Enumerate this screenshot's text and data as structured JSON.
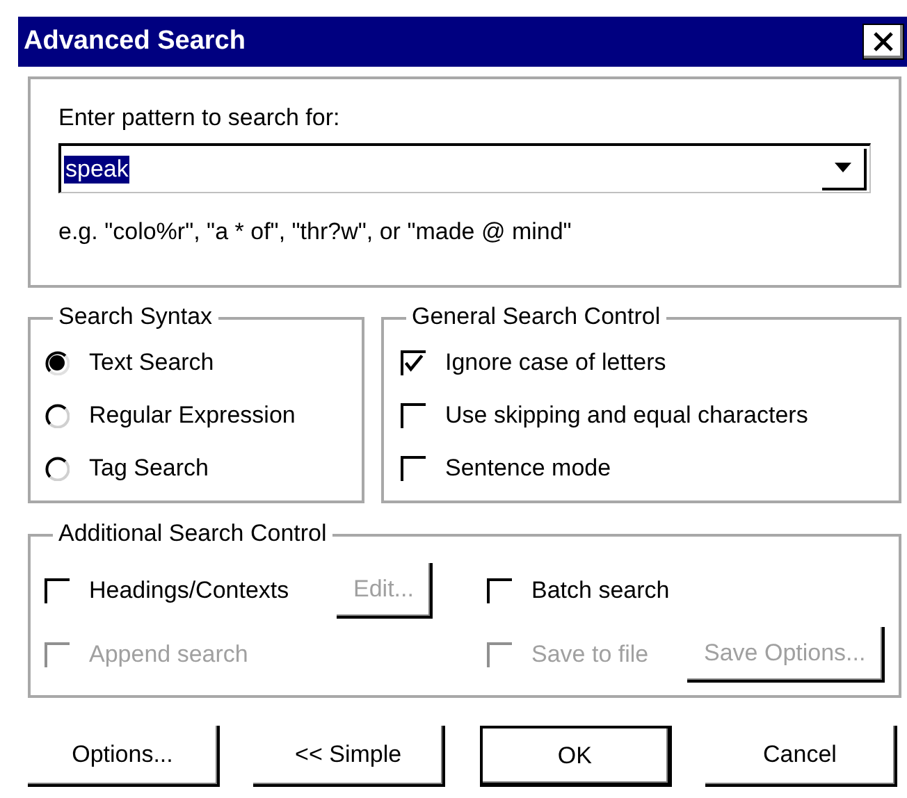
{
  "window": {
    "title": "Advanced Search"
  },
  "pattern": {
    "label": "Enter pattern to search for:",
    "value": "speak",
    "highlighted": true,
    "example": "e.g. \"colo%r\", \"a * of\", \"thr?w\", or \"made @ mind\""
  },
  "search_syntax": {
    "title": "Search Syntax",
    "options": [
      {
        "label": "Text Search",
        "selected": true
      },
      {
        "label": "Regular Expression",
        "selected": false
      },
      {
        "label": "Tag Search",
        "selected": false
      }
    ]
  },
  "general_search_control": {
    "title": "General Search Control",
    "options": [
      {
        "label": "Ignore case of letters",
        "checked": true
      },
      {
        "label": "Use skipping and equal characters",
        "checked": false
      },
      {
        "label": "Sentence mode",
        "checked": false
      }
    ]
  },
  "additional_search_control": {
    "title": "Additional Search Control",
    "rows": [
      {
        "left": [
          {
            "kind": "checkbox",
            "label": "Headings/Contexts",
            "checked": false,
            "disabled": false
          },
          {
            "kind": "button",
            "label": "Edit...",
            "disabled": true
          }
        ],
        "right": [
          {
            "kind": "checkbox",
            "label": "Batch search",
            "checked": false,
            "disabled": false
          }
        ]
      },
      {
        "left": [
          {
            "kind": "checkbox",
            "label": "Append search",
            "checked": false,
            "disabled": true
          }
        ],
        "right": [
          {
            "kind": "checkbox",
            "label": "Save to file",
            "checked": false,
            "disabled": true
          },
          {
            "kind": "button",
            "label": "Save Options...",
            "disabled": true
          }
        ]
      }
    ]
  },
  "buttons": [
    {
      "label": "Options...",
      "default": false
    },
    {
      "label": "<< Simple",
      "default": false
    },
    {
      "label": "OK",
      "default": true
    },
    {
      "label": "Cancel",
      "default": false
    }
  ]
}
